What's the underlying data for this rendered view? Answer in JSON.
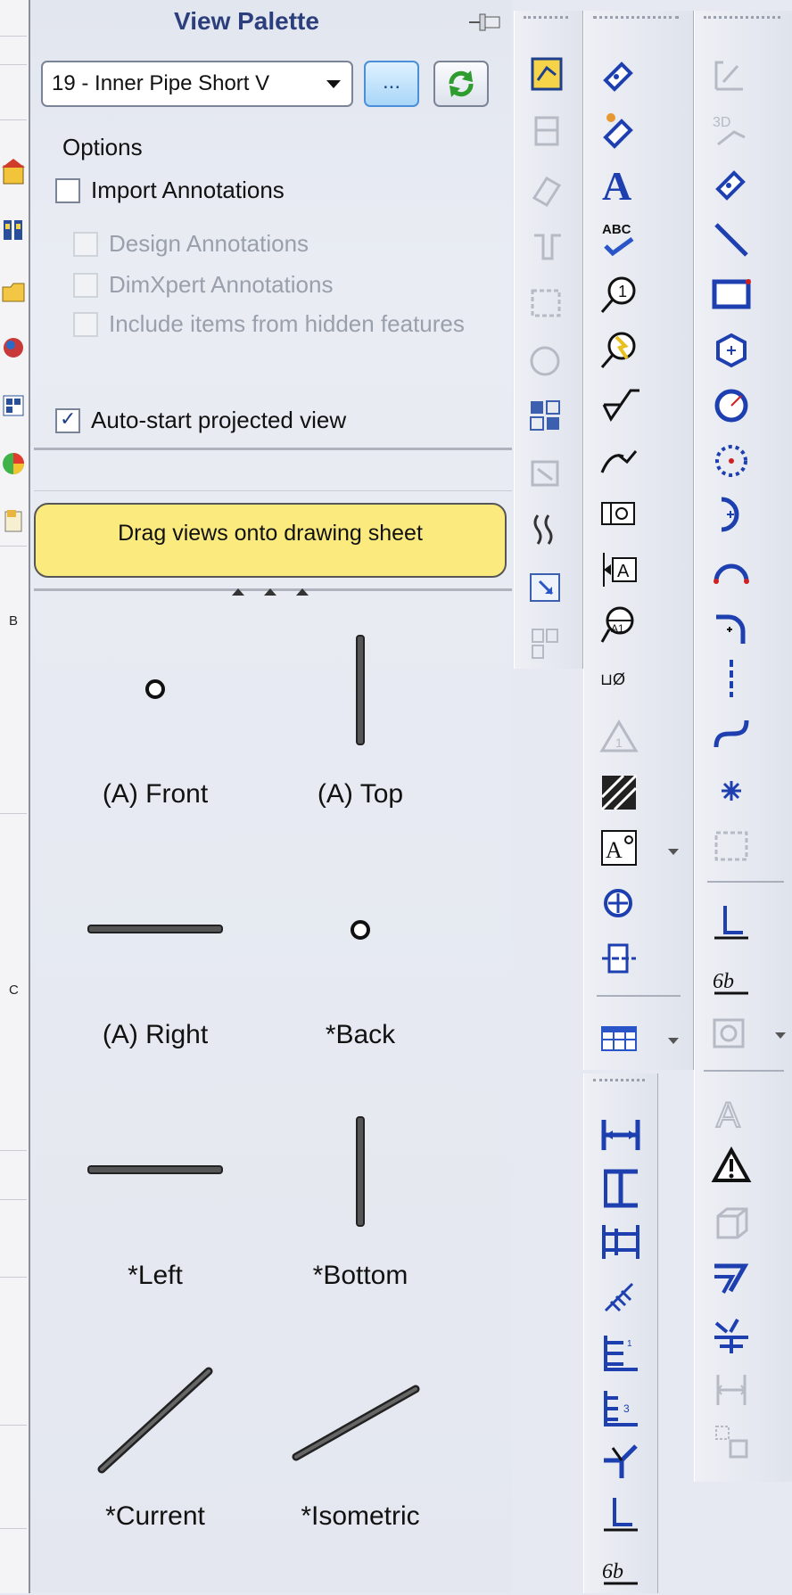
{
  "palette": {
    "title": "View Palette",
    "selected_view": "19 - Inner Pipe Short V",
    "browse_label": "...",
    "options_label": "Options",
    "options": [
      {
        "label": "Import Annotations",
        "checked": false,
        "enabled": true
      },
      {
        "label": "Design Annotations",
        "checked": false,
        "enabled": false
      },
      {
        "label": "DimXpert Annotations",
        "checked": false,
        "enabled": false
      },
      {
        "label": "Include items from hidden features",
        "checked": false,
        "enabled": false
      },
      {
        "label": "Auto-start projected view",
        "checked": true,
        "enabled": true
      }
    ],
    "drag_hint": "Drag views onto drawing sheet",
    "views": [
      {
        "label": "(A) Front",
        "shape": "circle"
      },
      {
        "label": "(A) Top",
        "shape": "vertical-line"
      },
      {
        "label": "(A) Right",
        "shape": "horizontal-line"
      },
      {
        "label": "*Back",
        "shape": "circle"
      },
      {
        "label": "*Left",
        "shape": "horizontal-line"
      },
      {
        "label": "*Bottom",
        "shape": "vertical-line"
      },
      {
        "label": "*Current",
        "shape": "diagonal-line"
      },
      {
        "label": "*Isometric",
        "shape": "diagonal-line"
      }
    ]
  },
  "left_strip": {
    "letters": [
      "B",
      "C"
    ]
  },
  "toolbars": {
    "view_layout_icons": [
      "model-view-icon",
      "projected-view-icon",
      "auxiliary-view-icon",
      "section-view-icon",
      "detail-view-icon",
      "broken-view-icon",
      "crop-view-icon",
      "alternate-position-icon",
      "break-line-icon",
      "relative-view-icon",
      "standard-3-view-icon"
    ],
    "annotation_icons": [
      "smart-dimension-icon",
      "model-items-icon",
      "note-icon",
      "spell-check-icon",
      "balloon-icon",
      "auto-balloon-icon",
      "surface-finish-icon",
      "weld-symbol-icon",
      "geometric-tolerance-icon",
      "datum-feature-icon",
      "datum-target-icon",
      "hole-callout-icon",
      "revision-symbol-icon",
      "area-hatch-icon",
      "blocks-icon",
      "center-mark-icon",
      "centerline-icon",
      "table-icon"
    ],
    "sketch_icons": [
      "sketch-icon",
      "3d-sketch-icon",
      "smart-dimension-icon",
      "line-icon",
      "rectangle-icon",
      "polygon-icon",
      "circle-icon",
      "perimeter-circle-icon",
      "arc-icon",
      "three-point-arc-icon",
      "tangent-arc-icon",
      "centerline-icon",
      "spline-icon",
      "point-icon",
      "sketch-picture-icon",
      "weld-bead-icon",
      "cosmetic-thread-icon",
      "hole-wizard-icon"
    ],
    "dimension_icons": [
      "horizontal-dimension-icon",
      "vertical-dimension-icon",
      "baseline-dimension-icon",
      "angular-running-icon",
      "ordinate-dimension-icon",
      "vertical-ordinate-icon",
      "chamfer-dimension-icon",
      "weld-symbol-icon",
      "surface-finish-icon"
    ],
    "misc_icons": [
      "text-icon",
      "revision-cloud-icon",
      "3d-view-icon",
      "path-icon",
      "align-icon",
      "dimension-palette-icon",
      "grouping-icon"
    ]
  }
}
